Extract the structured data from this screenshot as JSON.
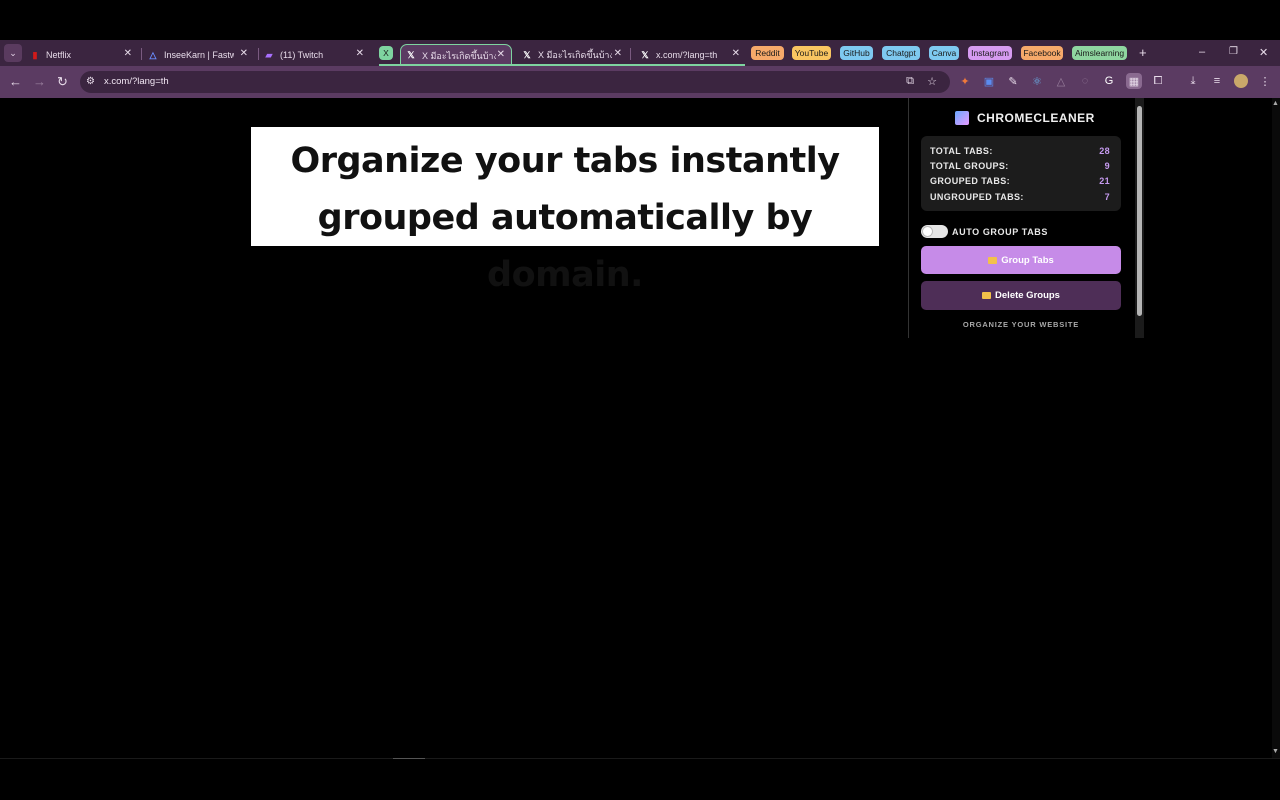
{
  "browser": {
    "tabs": [
      {
        "title": "Netflix",
        "favicon": "netflix-icon",
        "color": "#d11a1a"
      },
      {
        "title": "InseeKarn | Fastwo",
        "favicon": "fastwork-icon",
        "color": "#6a8cff"
      },
      {
        "title": "(11) Twitch",
        "favicon": "twitch-icon",
        "color": "#a970ff"
      },
      {
        "title": "X",
        "favicon": "x-group-chip",
        "color": "#7ed4a0"
      },
      {
        "title": "X มีอะไรเกิดขึ้นบ้าง / X",
        "favicon": "x-icon",
        "color": "#ffffff"
      },
      {
        "title": "X มีอะไรเกิดขึ้นบ้าง / X",
        "favicon": "x-icon",
        "color": "#ffffff"
      },
      {
        "title": "x.com/?lang=th",
        "favicon": "x-icon",
        "color": "#ffffff"
      }
    ],
    "tab_groups": [
      {
        "label": "Reddit",
        "color": "#f6a96a"
      },
      {
        "label": "YouTube",
        "color": "#f9c561"
      },
      {
        "label": "GitHub",
        "color": "#7ec9f0"
      },
      {
        "label": "Chatgpt",
        "color": "#7ec9f0"
      },
      {
        "label": "Canva",
        "color": "#7ec9f0"
      },
      {
        "label": "Instagram",
        "color": "#d69bf0"
      },
      {
        "label": "Facebook",
        "color": "#f6a96a"
      },
      {
        "label": "Aimslearning",
        "color": "#8fd6a0"
      }
    ],
    "new_tab": "+",
    "window_controls": {
      "minimize": "–",
      "restore": "❐",
      "close": "✕"
    },
    "url": "x.com/?lang=th"
  },
  "page": {
    "headline_line1": "Organize your tabs instantly",
    "headline_line2": "grouped automatically by domain."
  },
  "extension": {
    "name": "CHROMECLEANER",
    "stats": [
      {
        "label": "TOTAL TABS:",
        "value": "28"
      },
      {
        "label": "TOTAL GROUPS:",
        "value": "9"
      },
      {
        "label": "GROUPED TABS:",
        "value": "21"
      },
      {
        "label": "UNGROUPED TABS:",
        "value": "7"
      }
    ],
    "auto_group_label": "AUTO GROUP TABS",
    "auto_group_enabled": false,
    "group_button": "Group Tabs",
    "delete_button": "Delete Groups",
    "footer": "ORGANIZE YOUR WEBSITE",
    "accent": "#c68be8"
  }
}
